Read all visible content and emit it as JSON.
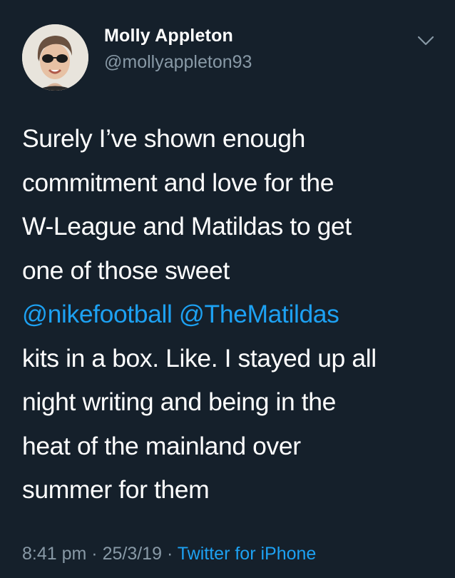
{
  "author": {
    "name": "Molly Appleton",
    "handle": "@mollyappleton93"
  },
  "tweet": {
    "lines": [
      "Surely I’ve shown enough",
      "commitment and love for the",
      "W-League and Matildas to get",
      "one of those sweet"
    ],
    "mentions": [
      "@nikefootball",
      "@TheMatildas"
    ],
    "lines_after": [
      "kits in a box. Like. I stayed up all",
      "night writing and being in the",
      "heat of the mainland over",
      "summer for them"
    ]
  },
  "meta": {
    "time": "8:41 pm",
    "date": "25/3/19",
    "separator": "·",
    "source": "Twitter for iPhone"
  },
  "icons": {
    "menu": "chevron-down-icon"
  },
  "colors": {
    "background": "#15202b",
    "text": "#ffffff",
    "secondary": "#8899a6",
    "link": "#1da1f2"
  }
}
